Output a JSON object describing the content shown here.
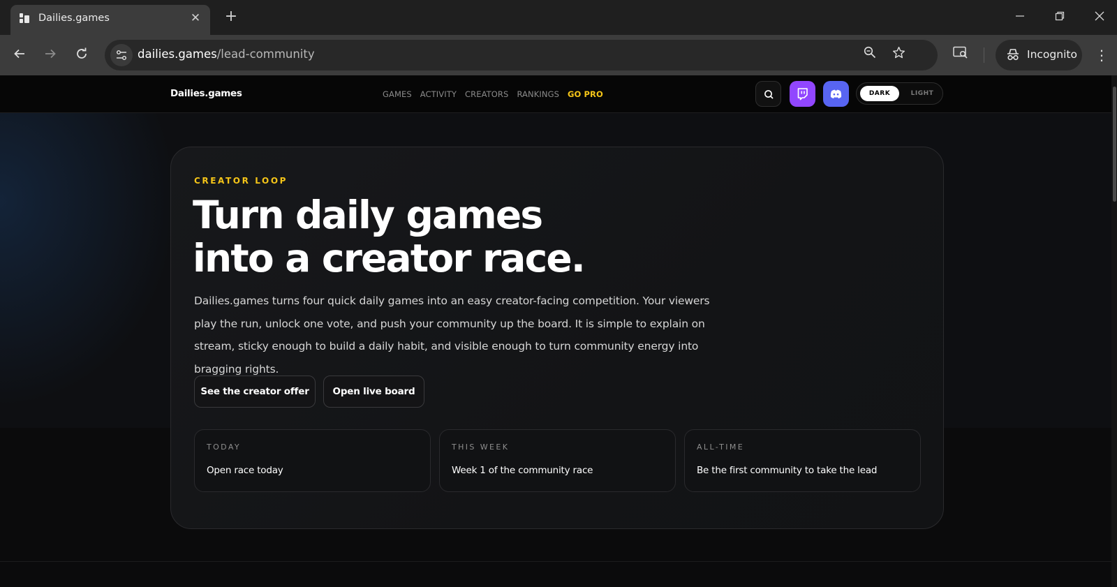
{
  "browser": {
    "tab_title": "Dailies.games",
    "url_host": "dailies.games",
    "url_path": "/lead-community",
    "profile_label": "Incognito"
  },
  "site": {
    "brand": "Dailies.games",
    "nav": [
      "GAMES",
      "ACTIVITY",
      "CREATORS",
      "RANKINGS",
      "GO PRO"
    ],
    "theme": {
      "dark_label": "DARK",
      "light_label": "LIGHT",
      "selected": "DARK"
    },
    "colors": {
      "accent": "#f5c518",
      "twitch": "#9146ff",
      "discord": "#5865f2"
    }
  },
  "hero": {
    "eyebrow": "CREATOR LOOP",
    "headline_line1": "Turn daily games",
    "headline_line2": "into a creator race.",
    "lede": "Dailies.games turns four quick daily games into an easy creator-facing competition. Your viewers play the run, unlock one vote, and push your community up the board. It is simple to explain on stream, sticky enough to build a daily habit, and visible enough to turn community energy into bragging rights.",
    "cta_primary": "See the creator offer",
    "cta_secondary": "Open live board",
    "stats": [
      {
        "label": "TODAY",
        "value": "Open race today"
      },
      {
        "label": "THIS WEEK",
        "value": "Week 1 of the community race"
      },
      {
        "label": "ALL-TIME",
        "value": "Be the first community to take the lead"
      }
    ]
  }
}
